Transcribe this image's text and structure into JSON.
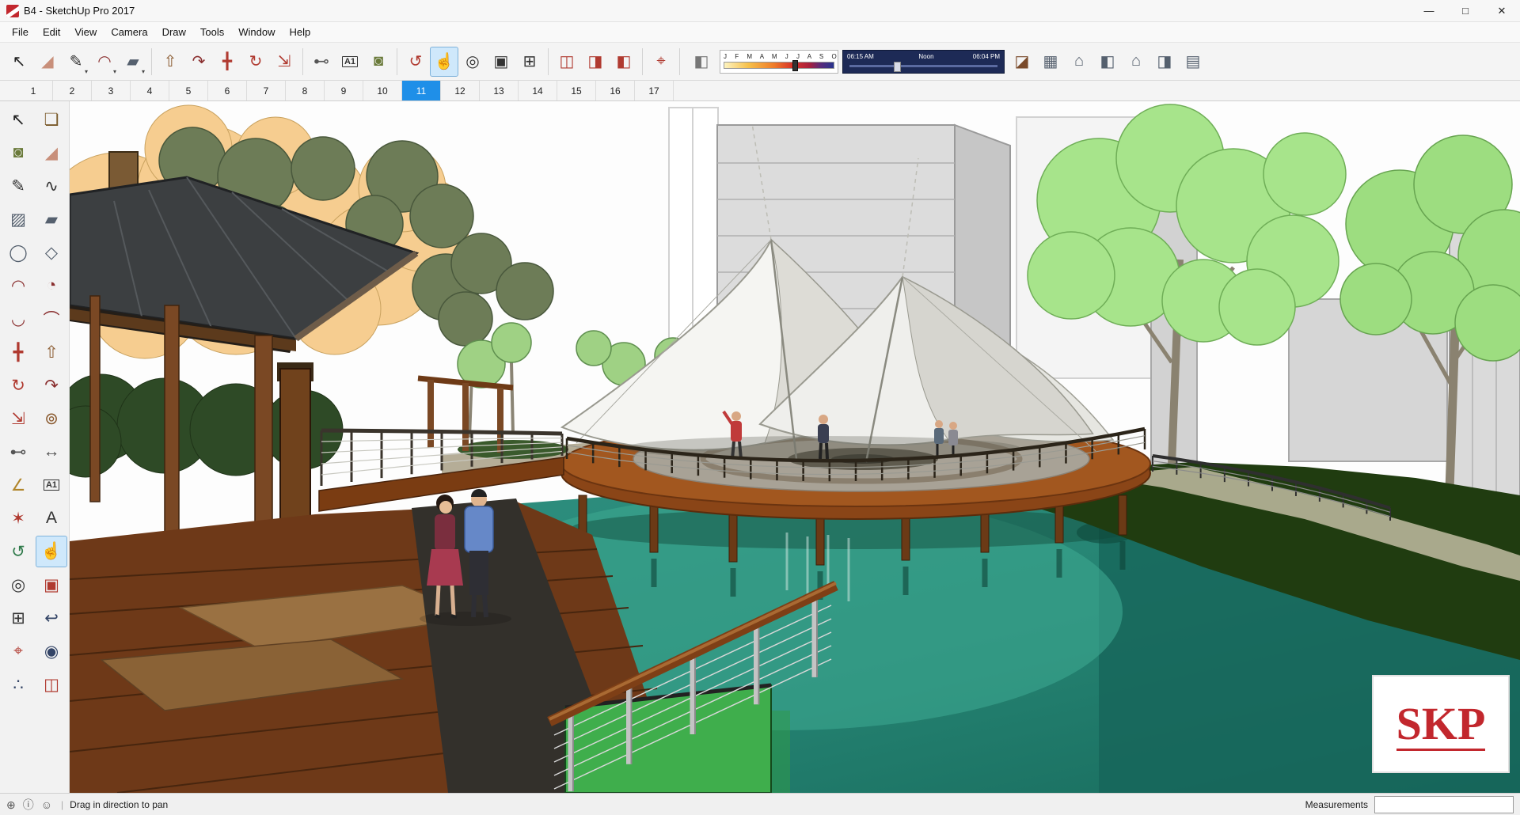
{
  "window": {
    "title": "B4 - SketchUp Pro 2017",
    "controls": {
      "minimize": "—",
      "maximize": "□",
      "close": "✕"
    }
  },
  "menubar": {
    "items": [
      "File",
      "Edit",
      "View",
      "Camera",
      "Draw",
      "Tools",
      "Window",
      "Help"
    ]
  },
  "toolbar": {
    "left_groups": [
      [
        {
          "name": "select-tool",
          "glyph": "↖",
          "color": "#222222"
        },
        {
          "name": "eraser-tool",
          "glyph": "◢",
          "color": "#c88f7a"
        },
        {
          "name": "line-tool",
          "glyph": "✎",
          "color": "#333333",
          "caret": true
        },
        {
          "name": "arc-tool",
          "glyph": "◠",
          "color": "#8a2f2f",
          "caret": true
        },
        {
          "name": "shapes-tool",
          "glyph": "▰",
          "color": "#55606e",
          "caret": true
        }
      ],
      [
        {
          "name": "push-pull-tool",
          "glyph": "⇧",
          "color": "#8a5a2f"
        },
        {
          "name": "follow-me-tool",
          "glyph": "↷",
          "color": "#8a2f2f"
        },
        {
          "name": "move-tool",
          "glyph": "╋",
          "color": "#b03a30"
        },
        {
          "name": "rotate-tool",
          "glyph": "↻",
          "color": "#b03a30"
        },
        {
          "name": "scale-tool",
          "glyph": "⇲",
          "color": "#b03a30"
        }
      ],
      [
        {
          "name": "tape-measure-tool",
          "glyph": "⊷",
          "color": "#555555"
        },
        {
          "name": "text-tool",
          "glyph": "A1",
          "color": "#333333",
          "boxed": true
        },
        {
          "name": "paint-bucket-tool",
          "glyph": "◙",
          "color": "#6a7a3a"
        }
      ],
      [
        {
          "name": "orbit-tool",
          "glyph": "↺",
          "color": "#b03a30"
        },
        {
          "name": "pan-tool",
          "glyph": "☝",
          "color": "#333333",
          "active": true
        },
        {
          "name": "zoom-tool",
          "glyph": "◎",
          "color": "#333333"
        },
        {
          "name": "zoom-window-tool",
          "glyph": "▣",
          "color": "#333333"
        },
        {
          "name": "zoom-extents-tool",
          "glyph": "⊞",
          "color": "#333333"
        }
      ],
      [
        {
          "name": "section-plane-tool",
          "glyph": "◫",
          "color": "#b03a30"
        },
        {
          "name": "display-section-planes-button",
          "glyph": "◨",
          "color": "#b03a30"
        },
        {
          "name": "display-section-cuts-button",
          "glyph": "◧",
          "color": "#b03a30"
        }
      ],
      [
        {
          "name": "position-camera-tool",
          "glyph": "⌖",
          "color": "#b03a30"
        }
      ]
    ],
    "shadow": {
      "months_display": "J F M A M J J A S O N D",
      "time_start": "06:15 AM",
      "time_noon": "Noon",
      "time_end": "06:04 PM"
    },
    "right_groups": [
      [
        {
          "name": "iso-view-button",
          "glyph": "◪",
          "color": "#7a4a2a"
        },
        {
          "name": "top-view-button",
          "glyph": "▦",
          "color": "#55606e"
        },
        {
          "name": "front-view-button",
          "glyph": "⌂",
          "color": "#55606e"
        },
        {
          "name": "right-view-button",
          "glyph": "◧",
          "color": "#55606e"
        },
        {
          "name": "back-view-button",
          "glyph": "⌂",
          "color": "#55606e"
        },
        {
          "name": "left-view-button",
          "glyph": "◨",
          "color": "#55606e"
        },
        {
          "name": "bottom-view-button",
          "glyph": "▤",
          "color": "#55606e"
        }
      ]
    ]
  },
  "scene_tabs": {
    "tabs": [
      "1",
      "2",
      "3",
      "4",
      "5",
      "6",
      "7",
      "8",
      "9",
      "10",
      "11",
      "12",
      "13",
      "14",
      "15",
      "16",
      "17"
    ],
    "active": "11"
  },
  "left_toolbar": {
    "tools": [
      {
        "name": "select-tool",
        "glyph": "↖",
        "color": "#222222"
      },
      {
        "name": "make-component-tool",
        "glyph": "❏",
        "color": "#7a5a2a"
      },
      {
        "name": "paint-bucket-tool",
        "glyph": "◙",
        "color": "#6a7a3a"
      },
      {
        "name": "eraser-tool",
        "glyph": "◢",
        "color": "#c88f7a"
      },
      {
        "name": "line-tool",
        "glyph": "✎",
        "color": "#333333"
      },
      {
        "name": "freehand-tool",
        "glyph": "∿",
        "color": "#333333"
      },
      {
        "name": "rectangle-tool",
        "glyph": "▨",
        "color": "#55606e"
      },
      {
        "name": "rotated-rectangle-tool",
        "glyph": "▰",
        "color": "#55606e"
      },
      {
        "name": "circle-tool",
        "glyph": "◯",
        "color": "#55606e"
      },
      {
        "name": "polygon-tool",
        "glyph": "◇",
        "color": "#55606e"
      },
      {
        "name": "arc-tool",
        "glyph": "◠",
        "color": "#8a2f2f"
      },
      {
        "name": "pie-tool",
        "glyph": "◔",
        "color": "#8a2f2f"
      },
      {
        "name": "two-point-arc-tool",
        "glyph": "◡",
        "color": "#8a2f2f"
      },
      {
        "name": "three-point-arc-tool",
        "glyph": "⌒",
        "color": "#8a2f2f"
      },
      {
        "name": "move-tool",
        "glyph": "╋",
        "color": "#b03a30"
      },
      {
        "name": "push-pull-tool",
        "glyph": "⇧",
        "color": "#8a5a2f"
      },
      {
        "name": "rotate-tool",
        "glyph": "↻",
        "color": "#b03a30"
      },
      {
        "name": "follow-me-tool",
        "glyph": "↷",
        "color": "#8a2f2f"
      },
      {
        "name": "scale-tool",
        "glyph": "⇲",
        "color": "#b03a30"
      },
      {
        "name": "offset-tool",
        "glyph": "⊚",
        "color": "#8a5a2f"
      },
      {
        "name": "tape-measure-tool",
        "glyph": "⊷",
        "color": "#555555"
      },
      {
        "name": "dimensions-tool",
        "glyph": "↔",
        "color": "#555555"
      },
      {
        "name": "protractor-tool",
        "glyph": "∠",
        "color": "#b0852a"
      },
      {
        "name": "text-tool",
        "glyph": "A1",
        "color": "#333333",
        "boxed": true
      },
      {
        "name": "axes-tool",
        "glyph": "✶",
        "color": "#b03a30"
      },
      {
        "name": "threed-text-tool",
        "glyph": "A",
        "color": "#333333"
      },
      {
        "name": "orbit-tool",
        "glyph": "↺",
        "color": "#2f7a4a"
      },
      {
        "name": "pan-tool",
        "glyph": "☝",
        "color": "#333333",
        "active": true
      },
      {
        "name": "zoom-tool",
        "glyph": "◎",
        "color": "#333333"
      },
      {
        "name": "zoom-window-tool",
        "glyph": "▣",
        "color": "#b03a30"
      },
      {
        "name": "zoom-extents-tool",
        "glyph": "⊞",
        "color": "#333333"
      },
      {
        "name": "zoom-previous-tool",
        "glyph": "↩",
        "color": "#334466"
      },
      {
        "name": "position-camera-tool",
        "glyph": "⌖",
        "color": "#b03a30"
      },
      {
        "name": "look-around-tool",
        "glyph": "◉",
        "color": "#334466"
      },
      {
        "name": "walk-tool",
        "glyph": "∴",
        "color": "#334466"
      },
      {
        "name": "section-plane-tool",
        "glyph": "◫",
        "color": "#b03a30"
      }
    ]
  },
  "statusbar": {
    "icons": [
      {
        "name": "geolocation-icon",
        "glyph": "⊕"
      },
      {
        "name": "credits-icon",
        "glyph": "ⓘ"
      },
      {
        "name": "sign-in-icon",
        "glyph": "☺"
      }
    ],
    "hint": "Drag in direction to pan",
    "measurements_label": "Measurements",
    "measurements_value": ""
  },
  "viewport": {
    "watermark": "SKP"
  }
}
